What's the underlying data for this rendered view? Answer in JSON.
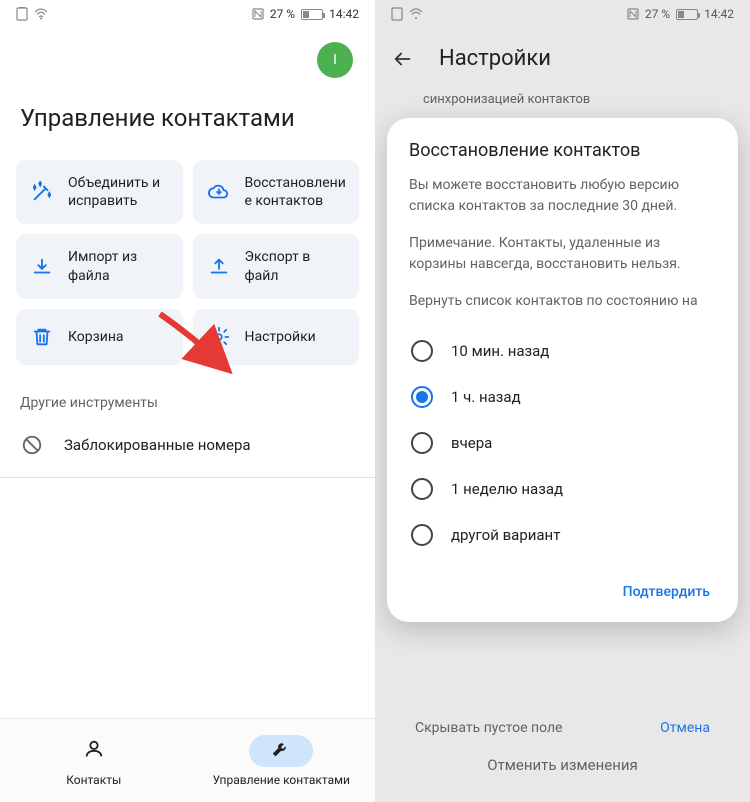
{
  "status": {
    "battery_text": "27 %",
    "time": "14:42"
  },
  "left": {
    "avatar_initial": "I",
    "title": "Управление контактами",
    "tiles": [
      {
        "id": "merge",
        "label": "Объединить и исправить"
      },
      {
        "id": "restore",
        "label": "Восстановление контактов"
      },
      {
        "id": "import",
        "label": "Импорт из файла"
      },
      {
        "id": "export",
        "label": "Экспорт в файл"
      },
      {
        "id": "trash",
        "label": "Корзина"
      },
      {
        "id": "settings",
        "label": "Настройки"
      }
    ],
    "other_tools_label": "Другие инструменты",
    "blocked_label": "Заблокированные номера",
    "nav": {
      "contacts": "Контакты",
      "manage": "Управление контактами"
    }
  },
  "right": {
    "header_title": "Настройки",
    "bg_sub": "синхронизацией контактов",
    "dialog": {
      "title": "Восстановление контактов",
      "body": "Вы можете восстановить любую версию списка контактов за последние 30 дней.",
      "note": "Примечание. Контакты, удаленные из корзины навсегда, восстановить нельзя.",
      "prompt": "Вернуть список контактов по состоянию на",
      "options": [
        {
          "label": "10 мин. назад",
          "selected": false
        },
        {
          "label": "1 ч. назад",
          "selected": true
        },
        {
          "label": "вчера",
          "selected": false
        },
        {
          "label": "1 неделю назад",
          "selected": false
        },
        {
          "label": "другой вариант",
          "selected": false
        }
      ],
      "confirm": "Подтвердить"
    },
    "bg_row_hide": "Скрывать пустое поле",
    "bg_row_cancel": "Отмена",
    "bg_undo": "Отменить изменения"
  }
}
